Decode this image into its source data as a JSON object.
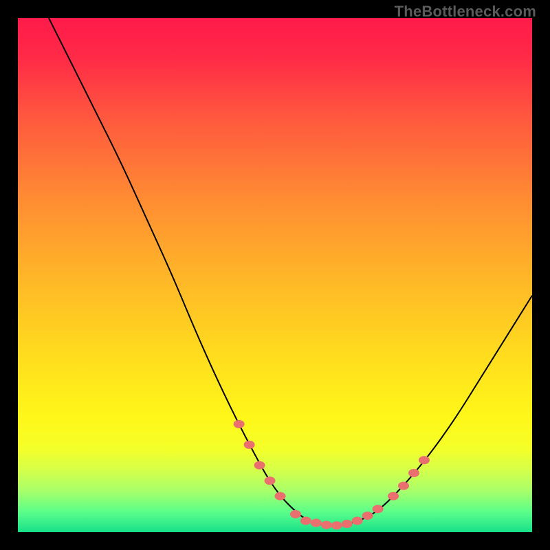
{
  "watermark": "TheBottleneck.com",
  "chart_data": {
    "type": "line",
    "title": "",
    "xlabel": "",
    "ylabel": "",
    "xlim": [
      0,
      100
    ],
    "ylim": [
      0,
      100
    ],
    "curve": [
      {
        "x": 6,
        "y": 100
      },
      {
        "x": 10,
        "y": 92
      },
      {
        "x": 15,
        "y": 82
      },
      {
        "x": 20,
        "y": 72
      },
      {
        "x": 25,
        "y": 61
      },
      {
        "x": 30,
        "y": 50
      },
      {
        "x": 35,
        "y": 38
      },
      {
        "x": 40,
        "y": 27
      },
      {
        "x": 45,
        "y": 17
      },
      {
        "x": 50,
        "y": 8
      },
      {
        "x": 55,
        "y": 3
      },
      {
        "x": 58,
        "y": 1.5
      },
      {
        "x": 62,
        "y": 1.2
      },
      {
        "x": 66,
        "y": 2
      },
      {
        "x": 70,
        "y": 4
      },
      {
        "x": 75,
        "y": 9
      },
      {
        "x": 80,
        "y": 15
      },
      {
        "x": 85,
        "y": 22
      },
      {
        "x": 90,
        "y": 30
      },
      {
        "x": 95,
        "y": 38
      },
      {
        "x": 100,
        "y": 46
      }
    ],
    "highlight_points": [
      {
        "x": 43,
        "y": 21
      },
      {
        "x": 45,
        "y": 17
      },
      {
        "x": 47,
        "y": 13
      },
      {
        "x": 49,
        "y": 10
      },
      {
        "x": 51,
        "y": 7
      },
      {
        "x": 54,
        "y": 3.5
      },
      {
        "x": 56,
        "y": 2.2
      },
      {
        "x": 58,
        "y": 1.8
      },
      {
        "x": 60,
        "y": 1.4
      },
      {
        "x": 62,
        "y": 1.3
      },
      {
        "x": 64,
        "y": 1.6
      },
      {
        "x": 66,
        "y": 2.2
      },
      {
        "x": 68,
        "y": 3.2
      },
      {
        "x": 70,
        "y": 4.5
      },
      {
        "x": 73,
        "y": 7
      },
      {
        "x": 75,
        "y": 9
      },
      {
        "x": 77,
        "y": 11.5
      },
      {
        "x": 79,
        "y": 14
      }
    ],
    "gradient_stops": [
      {
        "offset": 0.0,
        "color": "#ff1a4a"
      },
      {
        "offset": 0.08,
        "color": "#ff2b47"
      },
      {
        "offset": 0.2,
        "color": "#ff5a3e"
      },
      {
        "offset": 0.35,
        "color": "#ff8b33"
      },
      {
        "offset": 0.5,
        "color": "#ffb528"
      },
      {
        "offset": 0.65,
        "color": "#ffdb1e"
      },
      {
        "offset": 0.78,
        "color": "#fff819"
      },
      {
        "offset": 0.84,
        "color": "#f3ff2a"
      },
      {
        "offset": 0.88,
        "color": "#d4ff4a"
      },
      {
        "offset": 0.92,
        "color": "#a8ff6a"
      },
      {
        "offset": 0.96,
        "color": "#5cff8a"
      },
      {
        "offset": 1.0,
        "color": "#18e08a"
      }
    ],
    "highlight_color": "#e9706f",
    "curve_color": "#000000"
  }
}
